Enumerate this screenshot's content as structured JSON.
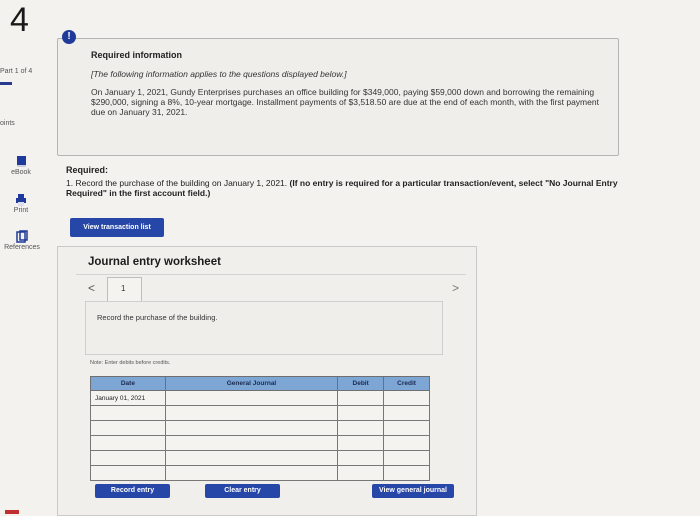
{
  "question_number": "4",
  "sidebar": {
    "part_label": "Part 1 of 4",
    "points_label": "oints",
    "items": [
      {
        "label": "eBook",
        "icon": "book-icon"
      },
      {
        "label": "Print",
        "icon": "printer-icon"
      },
      {
        "label": "References",
        "icon": "references-icon"
      }
    ]
  },
  "info": {
    "alert": "!",
    "title": "Required information",
    "italic_note": "[The following information applies to the questions displayed below.]",
    "body": "On January 1, 2021, Gundy Enterprises purchases an office building for $349,000, paying $59,000 down and borrowing the remaining $290,000, signing a 8%, 10-year mortgage. Installment payments of $3,518.50 are due at the end of each month, with the first payment due on January 31, 2021."
  },
  "required": {
    "title": "Required:",
    "text_plain": "1. Record the purchase of the building on January 1, 2021.",
    "text_bold": "(If no entry is required for a particular transaction/event, select \"No Journal Entry Required\" in the first account field.)"
  },
  "buttons": {
    "view_transaction_list": "View transaction list",
    "record_entry": "Record entry",
    "clear_entry": "Clear entry",
    "view_general_journal": "View general journal"
  },
  "worksheet": {
    "title": "Journal entry worksheet",
    "prev": "<",
    "next": ">",
    "tab": "1",
    "description": "Record the purchase of the building.",
    "note": "Note: Enter debits before credits.",
    "columns": [
      "Date",
      "General Journal",
      "Debit",
      "Credit"
    ],
    "rows": [
      {
        "date": "January 01, 2021",
        "account": "",
        "debit": "",
        "credit": ""
      },
      {
        "date": "",
        "account": "",
        "debit": "",
        "credit": ""
      },
      {
        "date": "",
        "account": "",
        "debit": "",
        "credit": ""
      },
      {
        "date": "",
        "account": "",
        "debit": "",
        "credit": ""
      },
      {
        "date": "",
        "account": "",
        "debit": "",
        "credit": ""
      },
      {
        "date": "",
        "account": "",
        "debit": "",
        "credit": ""
      }
    ]
  },
  "colors": {
    "accent": "#2747a8",
    "table_header": "#7da6d4"
  }
}
